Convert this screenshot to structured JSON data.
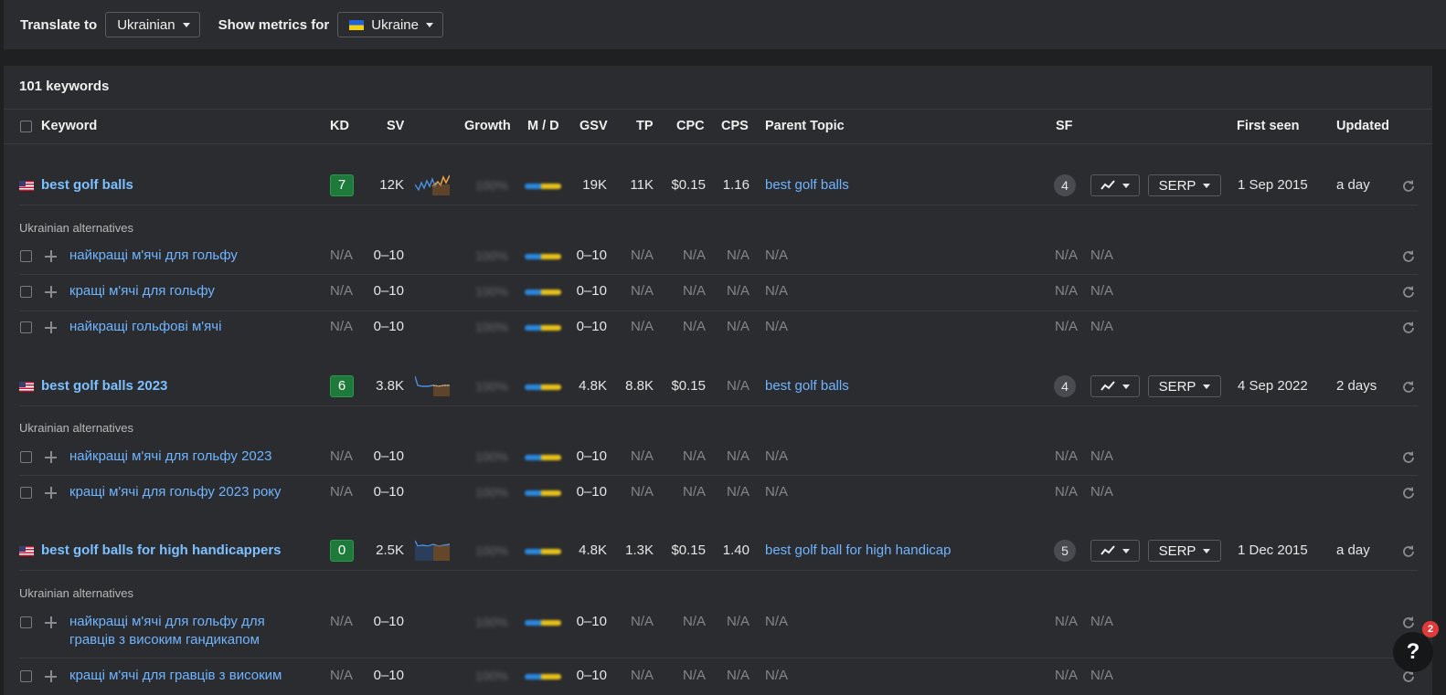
{
  "toolbar": {
    "translate_label": "Translate to",
    "translate_value": "Ukrainian",
    "metrics_label": "Show metrics for",
    "metrics_value": "Ukraine"
  },
  "summary": {
    "count": "101 keywords"
  },
  "columns": {
    "keyword": "Keyword",
    "kd": "KD",
    "sv": "SV",
    "growth": "Growth",
    "md": "M / D",
    "gsv": "GSV",
    "tp": "TP",
    "cpc": "CPC",
    "cps": "CPS",
    "parent": "Parent Topic",
    "sf": "SF",
    "first_seen": "First seen",
    "updated": "Updated"
  },
  "labels": {
    "alternatives": "Ukrainian alternatives",
    "growth_value": "100%",
    "serp": "SERP"
  },
  "groups": [
    {
      "keyword": "best golf balls",
      "kd": "7",
      "sv": "12K",
      "gsv": "19K",
      "tp": "11K",
      "cpc": "$0.15",
      "cps": "1.16",
      "parent": "best golf balls",
      "sf": "4",
      "first_seen": "1 Sep 2015",
      "updated": "a day",
      "alternatives": [
        {
          "keyword": "найкращі м'ячі для гольфу",
          "kd": "N/A",
          "sv": "0–10",
          "gsv": "0–10",
          "tp": "N/A",
          "cpc": "N/A",
          "cps": "N/A",
          "parent": "N/A",
          "sf": "N/A",
          "trend": "N/A"
        },
        {
          "keyword": "кращі м'ячі для гольфу",
          "kd": "N/A",
          "sv": "0–10",
          "gsv": "0–10",
          "tp": "N/A",
          "cpc": "N/A",
          "cps": "N/A",
          "parent": "N/A",
          "sf": "N/A",
          "trend": "N/A"
        },
        {
          "keyword": "найкращі гольфові м'ячі",
          "kd": "N/A",
          "sv": "0–10",
          "gsv": "0–10",
          "tp": "N/A",
          "cpc": "N/A",
          "cps": "N/A",
          "parent": "N/A",
          "sf": "N/A",
          "trend": "N/A"
        }
      ]
    },
    {
      "keyword": "best golf balls 2023",
      "kd": "6",
      "sv": "3.8K",
      "gsv": "4.8K",
      "tp": "8.8K",
      "cpc": "$0.15",
      "cps": "N/A",
      "parent": "best golf balls",
      "sf": "4",
      "first_seen": "4 Sep 2022",
      "updated": "2 days",
      "alternatives": [
        {
          "keyword": "найкращі м'ячі для гольфу 2023",
          "kd": "N/A",
          "sv": "0–10",
          "gsv": "0–10",
          "tp": "N/A",
          "cpc": "N/A",
          "cps": "N/A",
          "parent": "N/A",
          "sf": "N/A",
          "trend": "N/A"
        },
        {
          "keyword": "кращі м'ячі для гольфу 2023 року",
          "kd": "N/A",
          "sv": "0–10",
          "gsv": "0–10",
          "tp": "N/A",
          "cpc": "N/A",
          "cps": "N/A",
          "parent": "N/A",
          "sf": "N/A",
          "trend": "N/A"
        }
      ]
    },
    {
      "keyword": "best golf balls for high handicappers",
      "kd": "0",
      "sv": "2.5K",
      "gsv": "4.8K",
      "tp": "1.3K",
      "cpc": "$0.15",
      "cps": "1.40",
      "parent": "best golf ball for high handicap",
      "sf": "5",
      "first_seen": "1 Dec 2015",
      "updated": "a day",
      "alternatives": [
        {
          "keyword": "найкращі м'ячі для гольфу для",
          "keyword2": "гравців з високим гандикапом",
          "kd": "N/A",
          "sv": "0–10",
          "gsv": "0–10",
          "tp": "N/A",
          "cpc": "N/A",
          "cps": "N/A",
          "parent": "N/A",
          "sf": "N/A",
          "trend": "N/A"
        },
        {
          "keyword": "кращі м'ячі для гравців з високим",
          "kd": "N/A",
          "sv": "0–10",
          "gsv": "0–10",
          "tp": "N/A",
          "cpc": "N/A",
          "cps": "N/A",
          "parent": "N/A",
          "sf": "N/A",
          "trend": "N/A"
        }
      ]
    }
  ],
  "help": {
    "label": "?",
    "badge": "2"
  }
}
